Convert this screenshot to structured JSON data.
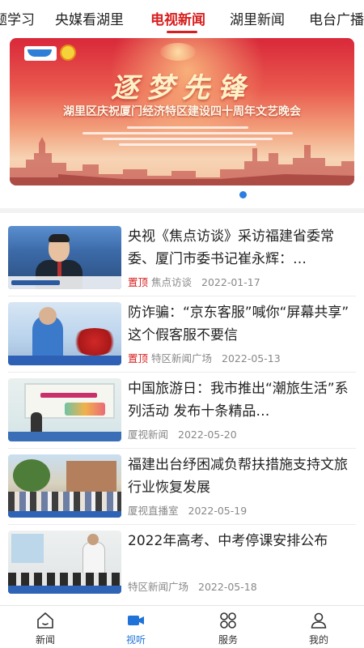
{
  "tabs": [
    {
      "label": "题学习",
      "active": false
    },
    {
      "label": "央媒看湖里",
      "active": false
    },
    {
      "label": "电视新闻",
      "active": true
    },
    {
      "label": "湖里新闻",
      "active": false
    },
    {
      "label": "电台广播",
      "active": false
    }
  ],
  "banner": {
    "emblem_text": "40周年",
    "hero_text": "逐梦先锋",
    "title": "湖里区庆祝厦门经济特区建设四十周年文艺晚会",
    "page_indicator": {
      "current": 1,
      "total": 1
    }
  },
  "news": [
    {
      "title": "央视《焦点访谈》采访福建省委常委、厦门市委书记崔永辉：…",
      "pinned": true,
      "pin_label": "置顶",
      "source": "焦点访谈",
      "date": "2022-01-17"
    },
    {
      "title": "防诈骗：“京东客服”喊你“屏幕共享” 这个假客服不要信",
      "pinned": true,
      "pin_label": "置顶",
      "source": "特区新闻广场",
      "date": "2022-05-13"
    },
    {
      "title": "中国旅游日：我市推出“潮旅生活”系列活动 发布十条精品…",
      "pinned": false,
      "pin_label": "",
      "source": "厦视新闻",
      "date": "2022-05-20"
    },
    {
      "title": "福建出台纾困减负帮扶措施支持文旅行业恢复发展",
      "pinned": false,
      "pin_label": "",
      "source": "厦视直播室",
      "date": "2022-05-19"
    },
    {
      "title": "2022年高考、中考停课安排公布",
      "pinned": false,
      "pin_label": "",
      "source": "特区新闻广场",
      "date": "2022-05-18"
    }
  ],
  "bottom_nav": [
    {
      "label": "新闻",
      "icon": "home-icon",
      "active": false
    },
    {
      "label": "视听",
      "icon": "video-camera-icon",
      "active": true
    },
    {
      "label": "服务",
      "icon": "grid-icon",
      "active": false
    },
    {
      "label": "我的",
      "icon": "user-icon",
      "active": false
    }
  ],
  "colors": {
    "accent_red": "#d81e1e",
    "accent_blue": "#1f73d8",
    "meta_gray": "#888888"
  }
}
